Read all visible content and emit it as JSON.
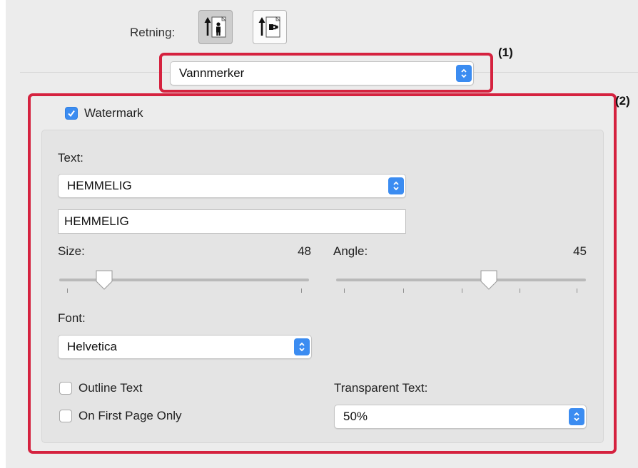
{
  "orientation": {
    "label": "Retning:",
    "options": [
      "portrait-icon",
      "landscape-icon"
    ],
    "selected": "portrait-icon"
  },
  "panel_menu": {
    "value": "Vannmerker"
  },
  "annotations": {
    "callout_1": "(1)",
    "callout_2": "(2)",
    "highlight_color": "#d5223f"
  },
  "watermark": {
    "enabled_label": "Watermark",
    "enabled": true,
    "text_label": "Text:",
    "text_preset": "HEMMELIG",
    "text_value": "HEMMELIG",
    "size_label": "Size:",
    "size_value": "48",
    "size_fraction": 0.18,
    "angle_label": "Angle:",
    "angle_value": "45",
    "angle_fraction": 0.61,
    "font_label": "Font:",
    "font_value": "Helvetica",
    "outline_label": "Outline Text",
    "outline_checked": false,
    "first_page_label": "On First Page Only",
    "first_page_checked": false,
    "transparent_label": "Transparent Text:",
    "transparent_value": "50%"
  },
  "colors": {
    "accent": "#3b8cf1",
    "panel_bg": "#ececec"
  }
}
